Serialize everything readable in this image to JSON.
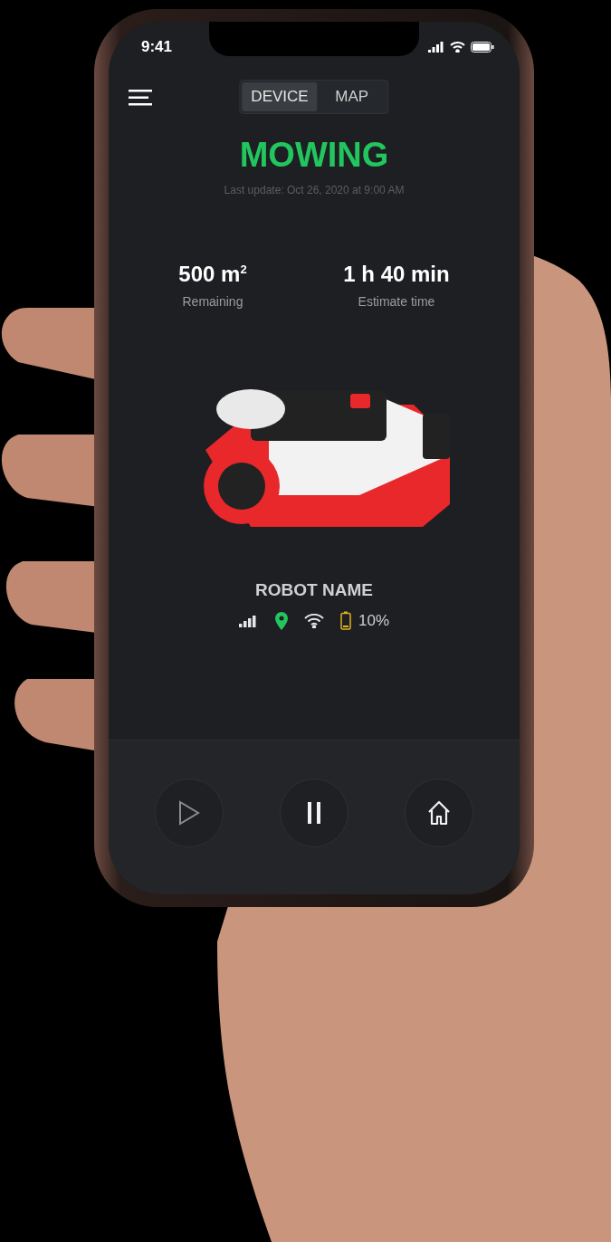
{
  "status_bar": {
    "time": "9:41"
  },
  "tabs": [
    {
      "label": "DEVICE",
      "selected": true
    },
    {
      "label": "MAP",
      "selected": false
    }
  ],
  "status": {
    "title": "MOWING",
    "subtitle": "Last update: Oct 26, 2020 at 9:00 AM"
  },
  "stats": [
    {
      "value": "500 m$^{2}$",
      "label": "Remaining"
    },
    {
      "value": "1 h 40 min",
      "label": "Estimate time"
    }
  ],
  "robot": {
    "name": "ROBOT NAME",
    "indicators": [
      {
        "kind": "signal",
        "color": "#e6e6e6"
      },
      {
        "kind": "location",
        "color": "#22c55e"
      },
      {
        "kind": "wifi",
        "color": "#e6e6e6"
      },
      {
        "kind": "battery",
        "color": "#e0b020",
        "reading": "10%"
      }
    ]
  },
  "controls": [
    {
      "kind": "play",
      "disabled": true
    },
    {
      "kind": "pause",
      "disabled": false
    },
    {
      "kind": "home",
      "disabled": false
    }
  ]
}
